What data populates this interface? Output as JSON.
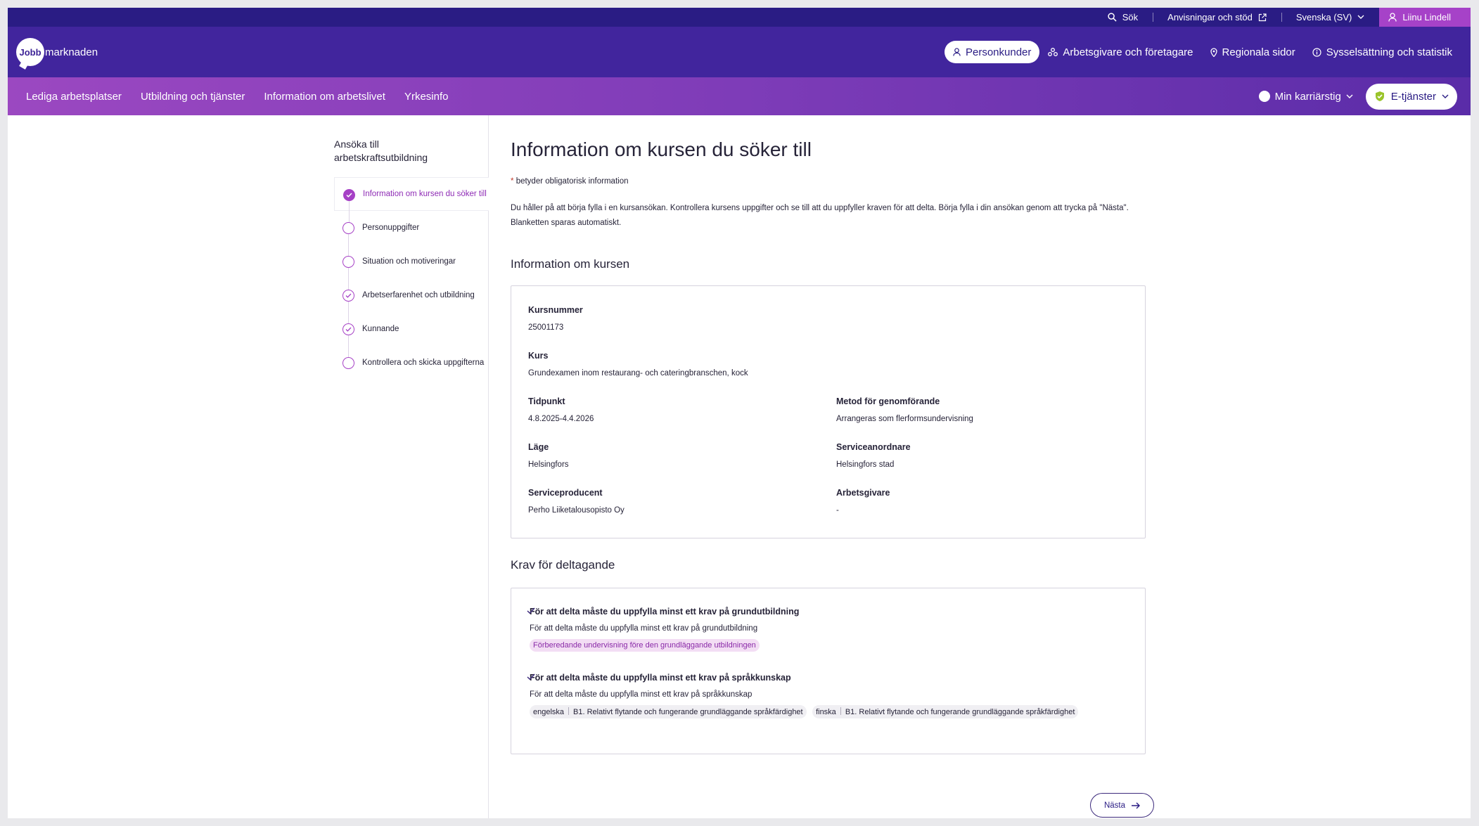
{
  "utility": {
    "search": "Sök",
    "guidance": "Anvisningar och stöd",
    "language": "Svenska (SV)",
    "user": "Liinu Lindell"
  },
  "header": {
    "logo_bubble": "Jobb",
    "logo_text": "marknaden",
    "nav": [
      "Personkunder",
      "Arbetsgivare och företagare",
      "Regionala sidor",
      "Sysselsättning och statistik"
    ]
  },
  "mainnav": {
    "items": [
      "Lediga arbetsplatser",
      "Utbildning och tjänster",
      "Information om arbetslivet",
      "Yrkesinfo"
    ],
    "career": "Min karriärstig",
    "eservices": "E-tjänster"
  },
  "sidebar": {
    "title": "Ansöka till arbetskraftsutbildning",
    "steps": [
      {
        "label": "Information om kursen du söker till",
        "state": "active"
      },
      {
        "label": "Personuppgifter",
        "state": "empty"
      },
      {
        "label": "Situation och motiveringar",
        "state": "empty"
      },
      {
        "label": "Arbetserfarenhet och utbildning",
        "state": "done"
      },
      {
        "label": "Kunnande",
        "state": "done"
      },
      {
        "label": "Kontrollera och skicka uppgifterna",
        "state": "empty"
      }
    ]
  },
  "main": {
    "title": "Information om kursen du söker till",
    "required_star": "*",
    "required_note": "betyder obligatorisk information",
    "intro": "Du håller på att börja fylla i en kursansökan. Kontrollera kursens uppgifter och se till att du uppfyller kraven för att delta. Börja fylla i din ansökan genom att trycka på \"Nästa\". Blanketten sparas automatiskt.",
    "course_heading": "Information om kursen",
    "course": {
      "number_label": "Kursnummer",
      "number": "25001173",
      "course_label": "Kurs",
      "course": "Grundexamen inom restaurang- och cateringbranschen, kock",
      "time_label": "Tidpunkt",
      "time": "4.8.2025-4.4.2026",
      "method_label": "Metod för genomförande",
      "method": "Arrangeras som flerformsundervisning",
      "location_label": "Läge",
      "location": "Helsingfors",
      "organizer_label": "Serviceanordnare",
      "organizer": "Helsingfors stad",
      "producer_label": "Serviceproducent",
      "producer": "Perho Liiketalousopisto Oy",
      "employer_label": "Arbetsgivare",
      "employer": "-"
    },
    "requirements_heading": "Krav för deltagande",
    "requirements": [
      {
        "title": "För att delta måste du uppfylla minst ett krav på grundutbildning",
        "sub": "För att delta måste du uppfylla minst ett krav på grundutbildning",
        "chip": "Förberedande undervisning före den grundläggande utbildningen"
      },
      {
        "title": "För att delta måste du uppfylla minst ett krav på språkkunskap",
        "sub": "För att delta måste du uppfylla minst ett krav på språkkunskap",
        "chips": [
          {
            "lang": "engelska",
            "level": "B1. Relativt flytande och fungerande grundläggande språkfärdighet"
          },
          {
            "lang": "finska",
            "level": "B1. Relativt flytande och fungerande grundläggande språkfärdighet"
          }
        ]
      }
    ],
    "next_label": "Nästa"
  },
  "colors": {
    "utility_bg": "#2a1c84",
    "header_bg": "#41259d",
    "nav_gradient_start": "#9b48c1",
    "accent": "#a641c6"
  }
}
